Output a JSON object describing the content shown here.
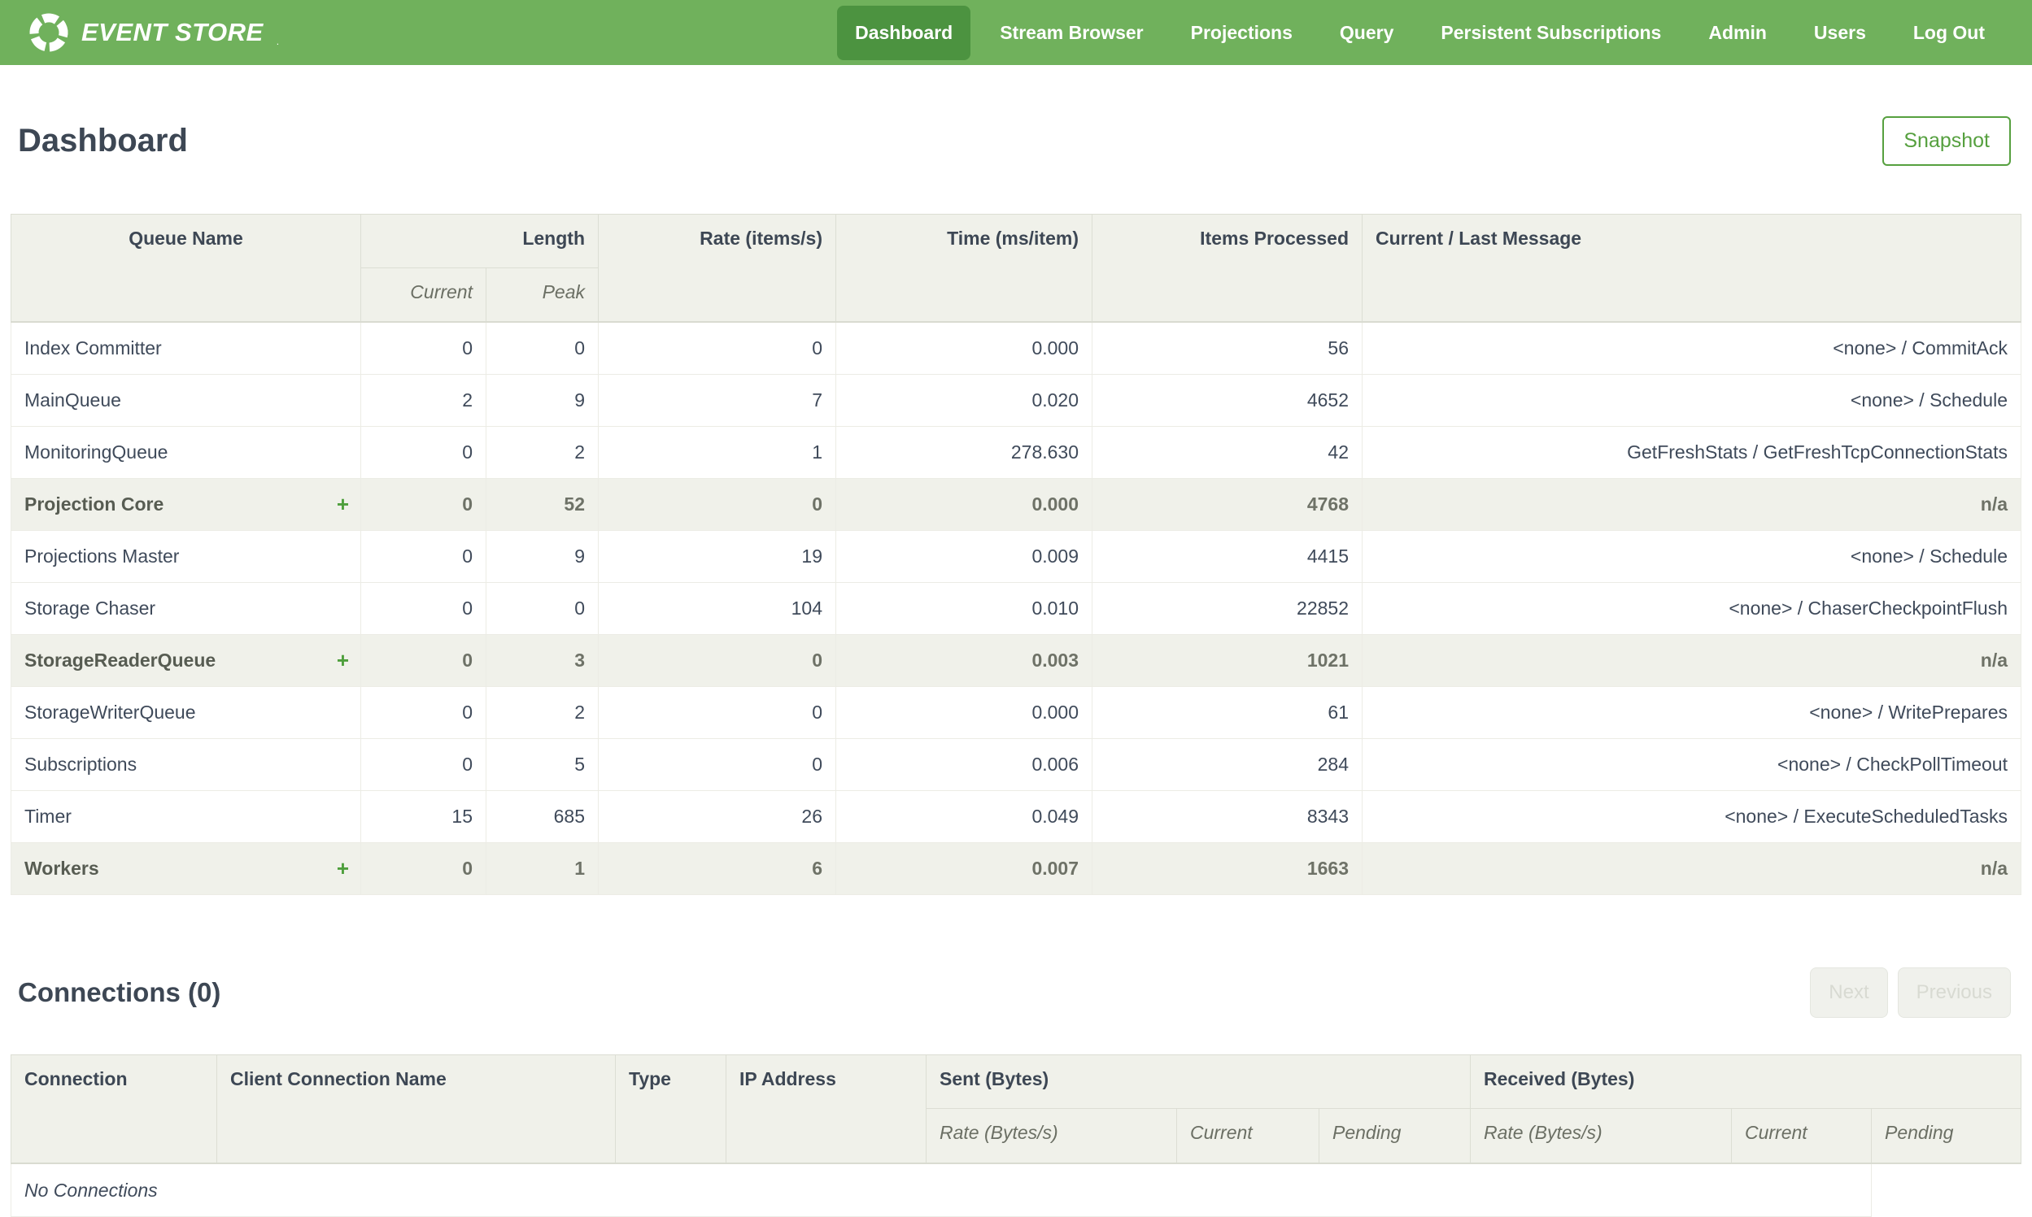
{
  "colors": {
    "header_green": "#70B15C",
    "active_green": "#4C9340",
    "accent_green": "#56A03F",
    "title_color": "#3D4754",
    "cell_text": "#3F4A5A",
    "panel_bg": "#F0F1EA"
  },
  "nav": {
    "brand": "EVENT STORE",
    "brand_mark": ".",
    "items": [
      {
        "label": "Dashboard",
        "active": true
      },
      {
        "label": "Stream Browser",
        "active": false
      },
      {
        "label": "Projections",
        "active": false
      },
      {
        "label": "Query",
        "active": false
      },
      {
        "label": "Persistent Subscriptions",
        "active": false
      },
      {
        "label": "Admin",
        "active": false
      },
      {
        "label": "Users",
        "active": false
      },
      {
        "label": "Log Out",
        "active": false
      }
    ]
  },
  "page": {
    "title": "Dashboard",
    "snapshot_label": "Snapshot"
  },
  "queues_table": {
    "headers": {
      "queue_name": "Queue Name",
      "length": "Length",
      "current": "Current",
      "peak": "Peak",
      "rate": "Rate (items/s)",
      "time": "Time (ms/item)",
      "items_processed": "Items Processed",
      "message": "Current / Last Message"
    },
    "expand_icon": "+",
    "rows": [
      {
        "name": "Index Committer",
        "group": false,
        "current": "0",
        "peak": "0",
        "rate": "0",
        "time": "0.000",
        "items": "56",
        "message": "<none> / CommitAck"
      },
      {
        "name": "MainQueue",
        "group": false,
        "current": "2",
        "peak": "9",
        "rate": "7",
        "time": "0.020",
        "items": "4652",
        "message": "<none> / Schedule"
      },
      {
        "name": "MonitoringQueue",
        "group": false,
        "current": "0",
        "peak": "2",
        "rate": "1",
        "time": "278.630",
        "items": "42",
        "message": "GetFreshStats / GetFreshTcpConnectionStats"
      },
      {
        "name": "Projection Core",
        "group": true,
        "current": "0",
        "peak": "52",
        "rate": "0",
        "time": "0.000",
        "items": "4768",
        "message": "n/a"
      },
      {
        "name": "Projections Master",
        "group": false,
        "current": "0",
        "peak": "9",
        "rate": "19",
        "time": "0.009",
        "items": "4415",
        "message": "<none> / Schedule"
      },
      {
        "name": "Storage Chaser",
        "group": false,
        "current": "0",
        "peak": "0",
        "rate": "104",
        "time": "0.010",
        "items": "22852",
        "message": "<none> / ChaserCheckpointFlush"
      },
      {
        "name": "StorageReaderQueue",
        "group": true,
        "current": "0",
        "peak": "3",
        "rate": "0",
        "time": "0.003",
        "items": "1021",
        "message": "n/a"
      },
      {
        "name": "StorageWriterQueue",
        "group": false,
        "current": "0",
        "peak": "2",
        "rate": "0",
        "time": "0.000",
        "items": "61",
        "message": "<none> / WritePrepares"
      },
      {
        "name": "Subscriptions",
        "group": false,
        "current": "0",
        "peak": "5",
        "rate": "0",
        "time": "0.006",
        "items": "284",
        "message": "<none> / CheckPollTimeout"
      },
      {
        "name": "Timer",
        "group": false,
        "current": "15",
        "peak": "685",
        "rate": "26",
        "time": "0.049",
        "items": "8343",
        "message": "<none> / ExecuteScheduledTasks"
      },
      {
        "name": "Workers",
        "group": true,
        "current": "0",
        "peak": "1",
        "rate": "6",
        "time": "0.007",
        "items": "1663",
        "message": "n/a"
      }
    ]
  },
  "connections": {
    "title": "Connections (0)",
    "next_label": "Next",
    "previous_label": "Previous",
    "headers": {
      "connection": "Connection",
      "client_name": "Client Connection Name",
      "type": "Type",
      "ip": "IP Address",
      "sent": "Sent (Bytes)",
      "received": "Received (Bytes)",
      "rate": "Rate (Bytes/s)",
      "current": "Current",
      "pending": "Pending"
    },
    "empty_message": "No Connections"
  }
}
